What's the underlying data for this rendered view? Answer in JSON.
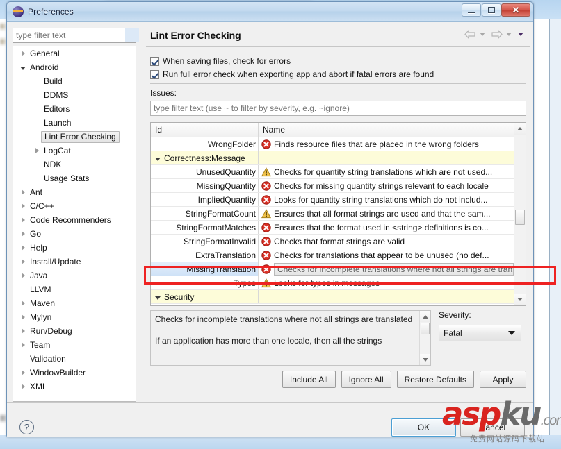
{
  "window": {
    "title": "Preferences",
    "icon": "eclipse-icon",
    "minimize_label": "Minimize",
    "maximize_label": "Maximize",
    "close_label": "Close",
    "close_glyph": "✕"
  },
  "filter": {
    "placeholder": "type filter text",
    "value": ""
  },
  "tree": {
    "items": [
      {
        "label": "General",
        "indent": 0,
        "twisty": "collapsed",
        "selected": false
      },
      {
        "label": "Android",
        "indent": 0,
        "twisty": "expanded",
        "selected": false
      },
      {
        "label": "Build",
        "indent": 1,
        "twisty": "none",
        "selected": false
      },
      {
        "label": "DDMS",
        "indent": 1,
        "twisty": "none",
        "selected": false
      },
      {
        "label": "Editors",
        "indent": 1,
        "twisty": "none",
        "selected": false
      },
      {
        "label": "Launch",
        "indent": 1,
        "twisty": "none",
        "selected": false
      },
      {
        "label": "Lint Error Checking",
        "indent": 1,
        "twisty": "none",
        "selected": true
      },
      {
        "label": "LogCat",
        "indent": 1,
        "twisty": "collapsed",
        "selected": false
      },
      {
        "label": "NDK",
        "indent": 1,
        "twisty": "none",
        "selected": false
      },
      {
        "label": "Usage Stats",
        "indent": 1,
        "twisty": "none",
        "selected": false
      },
      {
        "label": "Ant",
        "indent": 0,
        "twisty": "collapsed",
        "selected": false
      },
      {
        "label": "C/C++",
        "indent": 0,
        "twisty": "collapsed",
        "selected": false
      },
      {
        "label": "Code Recommenders",
        "indent": 0,
        "twisty": "collapsed",
        "selected": false
      },
      {
        "label": "Go",
        "indent": 0,
        "twisty": "collapsed",
        "selected": false
      },
      {
        "label": "Help",
        "indent": 0,
        "twisty": "collapsed",
        "selected": false
      },
      {
        "label": "Install/Update",
        "indent": 0,
        "twisty": "collapsed",
        "selected": false
      },
      {
        "label": "Java",
        "indent": 0,
        "twisty": "collapsed",
        "selected": false
      },
      {
        "label": "LLVM",
        "indent": 0,
        "twisty": "none",
        "selected": false
      },
      {
        "label": "Maven",
        "indent": 0,
        "twisty": "collapsed",
        "selected": false
      },
      {
        "label": "Mylyn",
        "indent": 0,
        "twisty": "collapsed",
        "selected": false
      },
      {
        "label": "Run/Debug",
        "indent": 0,
        "twisty": "collapsed",
        "selected": false
      },
      {
        "label": "Team",
        "indent": 0,
        "twisty": "collapsed",
        "selected": false
      },
      {
        "label": "Validation",
        "indent": 0,
        "twisty": "none",
        "selected": false
      },
      {
        "label": "WindowBuilder",
        "indent": 0,
        "twisty": "collapsed",
        "selected": false
      },
      {
        "label": "XML",
        "indent": 0,
        "twisty": "collapsed",
        "selected": false
      }
    ]
  },
  "page": {
    "title": "Lint Error Checking",
    "nav": {
      "back_label": "Back",
      "forward_label": "Forward",
      "menu_label": "View Menu"
    },
    "checkboxes": [
      {
        "label": "When saving files, check for errors",
        "checked": true
      },
      {
        "label": "Run full error check when exporting app and abort if fatal errors are found",
        "checked": true
      }
    ],
    "issues_label": "Issues:",
    "issues_filter_placeholder": "type filter text (use ~ to filter by severity, e.g. ~ignore)"
  },
  "table": {
    "columns": [
      "Id",
      "Name"
    ],
    "rows": [
      {
        "id": "WrongFolder",
        "severity": "error",
        "name": "Finds resource files that are placed in the wrong folders",
        "group": false,
        "selected": false
      },
      {
        "id": "Correctness:Message",
        "severity": "none",
        "name": "",
        "group": true,
        "selected": false
      },
      {
        "id": "UnusedQuantity",
        "severity": "warning",
        "name": "Checks for quantity string translations which are not used...",
        "group": false,
        "selected": false
      },
      {
        "id": "MissingQuantity",
        "severity": "error",
        "name": "Checks for missing quantity strings relevant to each locale",
        "group": false,
        "selected": false
      },
      {
        "id": "ImpliedQuantity",
        "severity": "error",
        "name": "Looks for quantity string translations which do not includ...",
        "group": false,
        "selected": false
      },
      {
        "id": "StringFormatCount",
        "severity": "warning",
        "name": "Ensures that all format strings are used and that the sam...",
        "group": false,
        "selected": false
      },
      {
        "id": "StringFormatMatches",
        "severity": "error",
        "name": "Ensures that the format used in <string> definitions is co...",
        "group": false,
        "selected": false
      },
      {
        "id": "StringFormatInvalid",
        "severity": "error",
        "name": "Checks that format strings are valid",
        "group": false,
        "selected": false
      },
      {
        "id": "ExtraTranslation",
        "severity": "error",
        "name": "Checks for translations that appear to be unused (no def...",
        "group": false,
        "selected": false
      },
      {
        "id": "MissingTranslation",
        "severity": "error",
        "name": "Checks for incomplete translations where not all strings are translated",
        "group": false,
        "selected": true
      },
      {
        "id": "Typos",
        "severity": "warning",
        "name": "Looks for typos in messages",
        "group": false,
        "selected": false
      },
      {
        "id": "Security",
        "severity": "none",
        "name": "",
        "group": true,
        "selected": false
      }
    ],
    "scroll_up_label": "Scroll up",
    "scroll_down_label": "Scroll down"
  },
  "description": {
    "paragraph1": "Checks for incomplete translations where not all strings are translated",
    "paragraph2": "If an application has more than one locale, then all the strings"
  },
  "severity": {
    "label": "Severity:",
    "value": "Fatal"
  },
  "buttons": {
    "include_all": "Include All",
    "ignore_all": "Ignore All",
    "restore_defaults": "Restore Defaults",
    "apply": "Apply",
    "ok": "OK",
    "cancel": "Cancel",
    "help": "?"
  },
  "watermark": {
    "part_red": "asp",
    "part_gray": "ku",
    "part_com": ".com",
    "subtitle": "免费网站源码下载站"
  },
  "colors": {
    "accent_blue": "#4c9fd4",
    "error_red": "#d93025",
    "warning_amber": "#e8b33a",
    "group_row": "#fdfcd9",
    "annotation_red": "#ee2222",
    "selection_blue": "#cfe2f7"
  }
}
